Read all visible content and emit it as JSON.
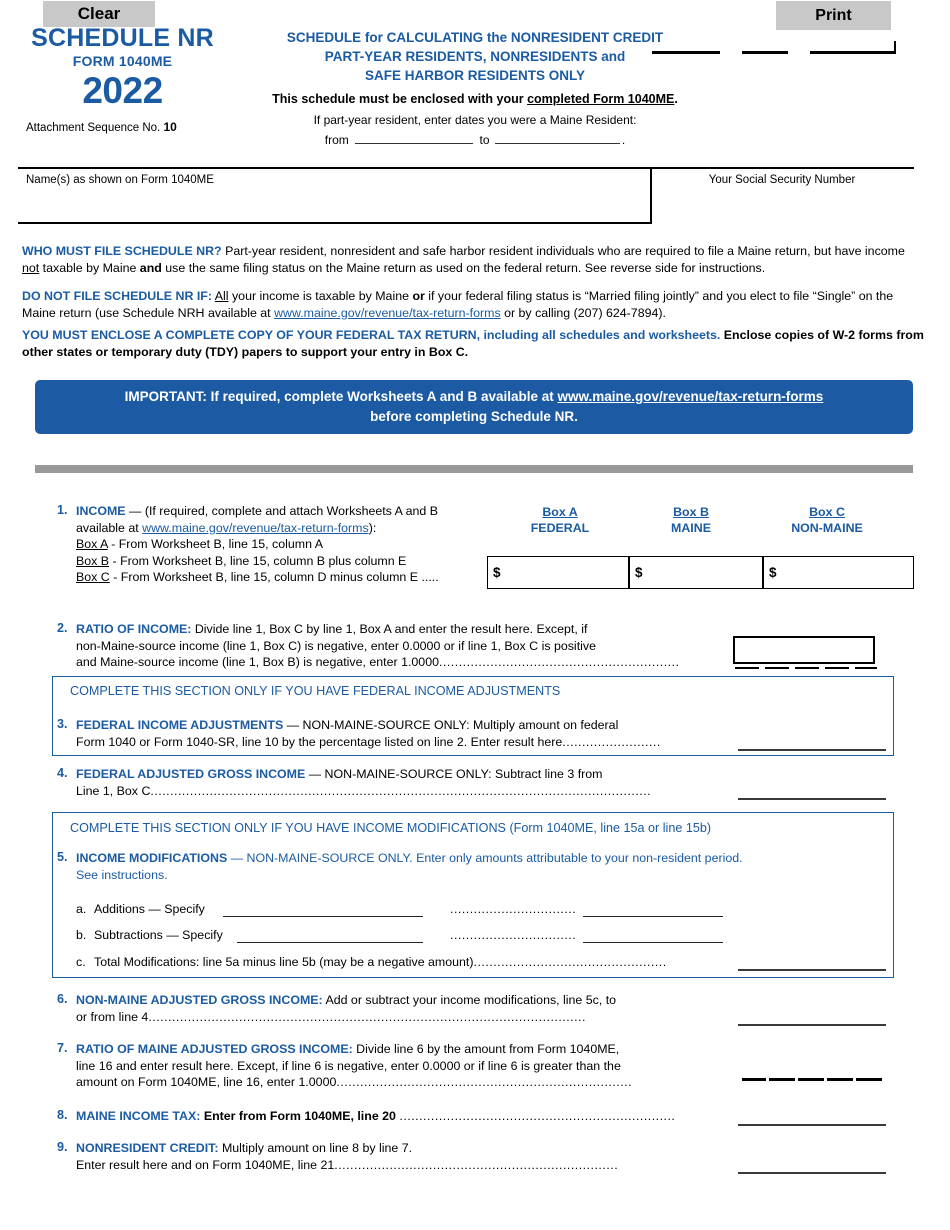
{
  "buttons": {
    "clear": "Clear",
    "print": "Print"
  },
  "header": {
    "schedule_title": "SCHEDULE NR",
    "form_number": "FORM 1040ME",
    "year": "2022",
    "attachment_prefix": "Attachment Sequence No. ",
    "attachment_number": "10",
    "center_line1": "SCHEDULE for CALCULATING the NONRESIDENT CREDIT",
    "center_line2": "PART-YEAR RESIDENTS, NONRESIDENTS and",
    "center_line3": "SAFE HARBOR RESIDENTS ONLY",
    "enclose_prefix": "This schedule must be enclosed with your ",
    "enclose_underlined": "completed Form 1040ME",
    "enclose_suffix": ".",
    "partyear_note": "If part-year resident, enter dates you were a Maine Resident:",
    "from_label": "from",
    "to_label": "to",
    "period_suffix": "."
  },
  "identity": {
    "name_label": "Name(s) as shown on Form 1040ME",
    "ssn_label": "Your Social Security Number"
  },
  "instructions": {
    "p1_heading": "WHO MUST FILE SCHEDULE NR?",
    "p1_a": " Part-year resident, nonresident and safe harbor resident individuals who are required to file a Maine return, but have income ",
    "p1_not": "not",
    "p1_b": " taxable by Maine ",
    "p1_and": "and",
    "p1_c": " use the same filing status on the Maine return as used on the federal return. See reverse side for instructions.",
    "p2_heading": "DO NOT FILE SCHEDULE NR IF:",
    "p2_all": "All",
    "p2_a": " your income is taxable by Maine ",
    "p2_or": "or",
    "p2_b": " if your federal filing status is “Married filing jointly” and you elect to file “Single” on the Maine return (use Schedule NRH available at ",
    "p2_link": "www.maine.gov/revenue/tax-return-forms",
    "p2_c": " or by calling (207) 624-7894).",
    "p3_heading": "YOU MUST ENCLOSE A COMPLETE COPY OF YOUR FEDERAL TAX RETURN,",
    "p3_a": " including all schedules and worksheets. ",
    "p3_b": "Enclose copies of W-2 forms from other states or temporary duty (TDY) papers to support your entry in Box C."
  },
  "important": {
    "prefix": "IMPORTANT: If required, complete Worksheets A and B available at ",
    "link": "www.maine.gov/revenue/tax-return-forms",
    "line2": "before completing Schedule NR."
  },
  "lines": {
    "l1": {
      "number": "1.",
      "title": "INCOME",
      "t1": " — (If required, complete and attach Worksheets A and B",
      "t2_prefix": "available at ",
      "t2_link": "www.maine.gov/revenue/tax-return-forms",
      "t2_suffix": "):",
      "boxa_u": "Box A",
      "boxa_rest": " - From Worksheet B, line 15, column A",
      "boxb_u": "Box B",
      "boxb_rest": " - From Worksheet B, line 15, column B plus column E",
      "boxc_u": "Box C",
      "boxc_rest": " - From Worksheet B, line 15, column D minus column E .....",
      "col_a_top": "Box A",
      "col_a_bot": "FEDERAL",
      "col_b_top": "Box B",
      "col_b_bot": "MAINE",
      "col_c_top": "Box C",
      "col_c_bot": "NON-MAINE",
      "currency": "$"
    },
    "l2": {
      "number": "2.",
      "title": "RATIO OF INCOME:",
      "t1": " Divide line 1, Box C by line 1, Box A and enter the result here. Except, if",
      "t2": "non-Maine-source income (line 1, Box C) is negative, enter 0.0000 or if line 1, Box C is positive",
      "t3": "and Maine-source income (line 1, Box B) is negative, enter 1.0000",
      "dots": "............................................................."
    },
    "sec_a_header": "COMPLETE THIS SECTION ONLY IF YOU HAVE FEDERAL INCOME ADJUSTMENTS",
    "l3": {
      "number": "3.",
      "title": "FEDERAL INCOME ADJUSTMENTS",
      "t1": " — NON-MAINE-SOURCE ONLY: Multiply amount on federal",
      "t2": "Form 1040 or Form 1040-SR, line 10 by the percentage listed on line 2. Enter result here",
      "dots": "........................."
    },
    "l4": {
      "number": "4.",
      "title": "FEDERAL ADJUSTED GROSS INCOME",
      "t1": " — NON-MAINE-SOURCE ONLY: Subtract line 3 from",
      "t2": "Line 1, Box C",
      "dots": "..............................................................................................................................."
    },
    "sec_b_header": "COMPLETE THIS SECTION ONLY IF YOU HAVE INCOME MODIFICATIONS (Form 1040ME, line 15a or line 15b)",
    "l5": {
      "number": "5.",
      "title": "INCOME MODIFICATIONS",
      "t1": " — NON-MAINE-SOURCE ONLY. Enter only amounts attributable to your non-resident period.",
      "t2": "See instructions.",
      "a_label": "a.",
      "a_text": "Additions — Specify",
      "a_dots": "................................",
      "b_label": "b.",
      "b_text": "Subtractions — Specify",
      "b_dots": "................................",
      "c_label": "c.",
      "c_text": "Total Modifications: line 5a minus line 5b (may be a negative amount)",
      "c_dots": "................................................."
    },
    "l6": {
      "number": "6.",
      "title": "NON-MAINE ADJUSTED GROSS INCOME:",
      "t1": " Add or subtract your income modifications, line 5c, to",
      "t2": "or from line 4",
      "dots": "..............................................................................................................."
    },
    "l7": {
      "number": "7.",
      "title": "RATIO OF MAINE ADJUSTED GROSS INCOME:",
      "t1": " Divide line 6 by the amount from Form 1040ME,",
      "t2": "line 16 and enter result here. Except, if line 6 is negative, enter 0.0000 or if line 6 is greater than the",
      "t3": "amount on Form 1040ME, line 16, enter 1.0000",
      "dots": "..........................................................................."
    },
    "l8": {
      "number": "8.",
      "title": "MAINE INCOME TAX:",
      "t1": " Enter from Form 1040ME, line 20 ",
      "dots": "......................................................................"
    },
    "l9": {
      "number": "9.",
      "title": "NONRESIDENT CREDIT:",
      "t1": " Multiply amount on line 8 by line 7.",
      "t2": "Enter result here and on Form 1040ME, line 21",
      "dots": "........................................................................"
    }
  },
  "colors": {
    "brand_blue": "#1b5ba3",
    "button_gray": "#c8c8c8",
    "divider_gray": "#989898"
  }
}
